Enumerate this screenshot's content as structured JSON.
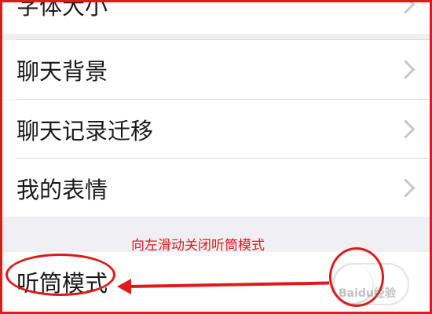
{
  "settings_list": {
    "items": [
      {
        "label": "字体大小"
      },
      {
        "label": "聊天背景"
      },
      {
        "label": "聊天记录迁移"
      },
      {
        "label": "我的表情"
      }
    ],
    "earpiece_mode": {
      "label": "听筒模式",
      "toggle_on": false
    }
  },
  "annotation": {
    "text": "向左滑动关闭听筒模式",
    "color": "#e01a1a"
  },
  "watermark": {
    "text": "Baidu经验"
  }
}
